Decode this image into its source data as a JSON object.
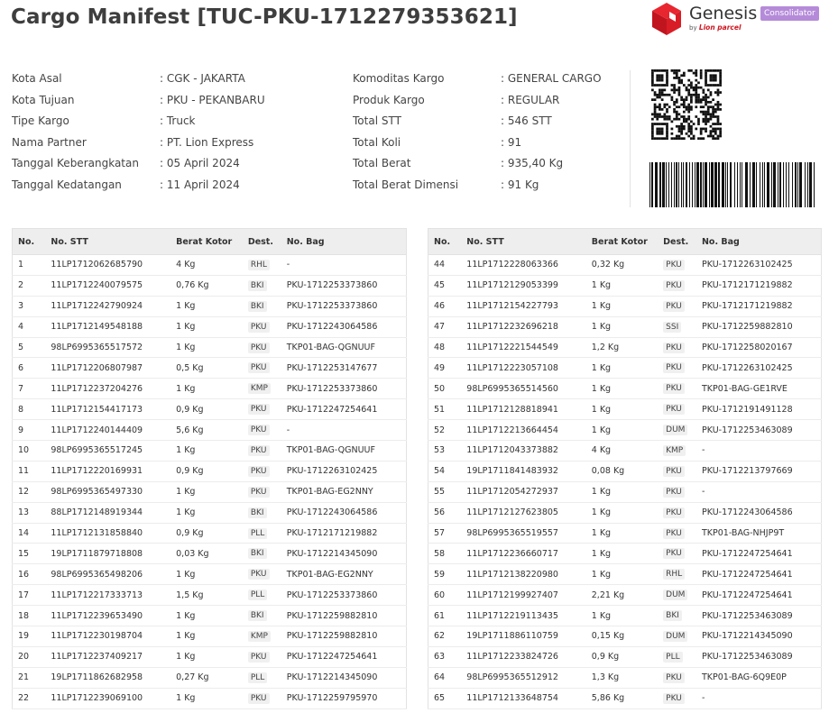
{
  "title": "Cargo Manifest [TUC-PKU-1712279353621]",
  "brand": {
    "name": "Genesis",
    "by": "by",
    "sub": "Lion parcel",
    "badge": "Consolidator",
    "accent": "#d0161f",
    "badge_color": "#b58bd9"
  },
  "info_left": [
    {
      "label": "Kota Asal",
      "value": ": CGK - JAKARTA"
    },
    {
      "label": "Kota Tujuan",
      "value": ": PKU - PEKANBARU"
    },
    {
      "label": "Tipe Kargo",
      "value": ": Truck"
    },
    {
      "label": "Nama Partner",
      "value": ": PT. Lion Express"
    },
    {
      "label": "Tanggal Keberangkatan",
      "value": ": 05 April 2024"
    },
    {
      "label": "Tanggal Kedatangan",
      "value": ": 11 April 2024"
    }
  ],
  "info_right": [
    {
      "label": "Komoditas Kargo",
      "value": ": GENERAL CARGO"
    },
    {
      "label": "Produk Kargo",
      "value": ": REGULAR"
    },
    {
      "label": "Total STT",
      "value": ": 546 STT"
    },
    {
      "label": "Total Koli",
      "value": ": 91"
    },
    {
      "label": "Total Berat",
      "value": ": 935,40 Kg"
    },
    {
      "label": "Total Berat Dimensi",
      "value": ": 91 Kg"
    }
  ],
  "table_headers": [
    "No.",
    "No. STT",
    "Berat Kotor",
    "Dest.",
    "No. Bag"
  ],
  "rows_left": [
    [
      "1",
      "11LP1712062685790",
      "4 Kg",
      "RHL",
      "-"
    ],
    [
      "2",
      "11LP1712240079575",
      "0,76 Kg",
      "BKI",
      "PKU-1712253373860"
    ],
    [
      "3",
      "11LP1712242790924",
      "1 Kg",
      "BKI",
      "PKU-1712253373860"
    ],
    [
      "4",
      "11LP1712149548188",
      "1 Kg",
      "PKU",
      "PKU-1712243064586"
    ],
    [
      "5",
      "98LP6995365517572",
      "1 Kg",
      "PKU",
      "TKP01-BAG-QGNUUF"
    ],
    [
      "6",
      "11LP1712206807987",
      "0,5 Kg",
      "PKU",
      "PKU-1712253147677"
    ],
    [
      "7",
      "11LP1712237204276",
      "1 Kg",
      "KMP",
      "PKU-1712253373860"
    ],
    [
      "8",
      "11LP1712154417173",
      "0,9 Kg",
      "PKU",
      "PKU-1712247254641"
    ],
    [
      "9",
      "11LP1712240144409",
      "5,6 Kg",
      "PKU",
      "-"
    ],
    [
      "10",
      "98LP6995365517245",
      "1 Kg",
      "PKU",
      "TKP01-BAG-QGNUUF"
    ],
    [
      "11",
      "11LP1712220169931",
      "0,9 Kg",
      "PKU",
      "PKU-1712263102425"
    ],
    [
      "12",
      "98LP6995365497330",
      "1 Kg",
      "PKU",
      "TKP01-BAG-EG2NNY"
    ],
    [
      "13",
      "88LP1712148919344",
      "1 Kg",
      "BKI",
      "PKU-1712243064586"
    ],
    [
      "14",
      "11LP1712131858840",
      "0,9 Kg",
      "PLL",
      "PKU-1712171219882"
    ],
    [
      "15",
      "19LP1711879718808",
      "0,03 Kg",
      "BKI",
      "PKU-1712214345090"
    ],
    [
      "16",
      "98LP6995365498206",
      "1 Kg",
      "PKU",
      "TKP01-BAG-EG2NNY"
    ],
    [
      "17",
      "11LP1712217333713",
      "1,5 Kg",
      "PLL",
      "PKU-1712253373860"
    ],
    [
      "18",
      "11LP1712239653490",
      "1 Kg",
      "BKI",
      "PKU-1712259882810"
    ],
    [
      "19",
      "11LP1712230198704",
      "1 Kg",
      "KMP",
      "PKU-1712259882810"
    ],
    [
      "20",
      "11LP1712237409217",
      "1 Kg",
      "PKU",
      "PKU-1712247254641"
    ],
    [
      "21",
      "19LP1711862682958",
      "0,27 Kg",
      "PLL",
      "PKU-1712214345090"
    ],
    [
      "22",
      "11LP1712239069100",
      "1 Kg",
      "PKU",
      "PKU-1712259795970"
    ]
  ],
  "rows_right": [
    [
      "44",
      "11LP1712228063366",
      "0,32 Kg",
      "PKU",
      "PKU-1712263102425"
    ],
    [
      "45",
      "11LP1712129053399",
      "1 Kg",
      "PKU",
      "PKU-1712171219882"
    ],
    [
      "46",
      "11LP1712154227793",
      "1 Kg",
      "PKU",
      "PKU-1712171219882"
    ],
    [
      "47",
      "11LP1712232696218",
      "1 Kg",
      "SSI",
      "PKU-1712259882810"
    ],
    [
      "48",
      "11LP1712221544549",
      "1,2 Kg",
      "PKU",
      "PKU-1712258020167"
    ],
    [
      "49",
      "11LP1712223057108",
      "1 Kg",
      "PKU",
      "PKU-1712263102425"
    ],
    [
      "50",
      "98LP6995365514560",
      "1 Kg",
      "PKU",
      "TKP01-BAG-GE1RVE"
    ],
    [
      "51",
      "11LP1712128818941",
      "1 Kg",
      "PKU",
      "PKU-1712191491128"
    ],
    [
      "52",
      "11LP1712213664454",
      "1 Kg",
      "DUM",
      "PKU-1712253463089"
    ],
    [
      "53",
      "11LP1712043373882",
      "4 Kg",
      "KMP",
      "-"
    ],
    [
      "54",
      "19LP1711841483932",
      "0,08 Kg",
      "PKU",
      "PKU-1712213797669"
    ],
    [
      "55",
      "11LP1712054272937",
      "1 Kg",
      "PKU",
      "-"
    ],
    [
      "56",
      "11LP1712127623805",
      "1 Kg",
      "PKU",
      "PKU-1712243064586"
    ],
    [
      "57",
      "98LP6995365519557",
      "1 Kg",
      "PKU",
      "TKP01-BAG-NHJP9T"
    ],
    [
      "58",
      "11LP1712236660717",
      "1 Kg",
      "PKU",
      "PKU-1712247254641"
    ],
    [
      "59",
      "11LP1712138220980",
      "1 Kg",
      "RHL",
      "PKU-1712247254641"
    ],
    [
      "60",
      "11LP1712199927407",
      "2,21 Kg",
      "DUM",
      "PKU-1712247254641"
    ],
    [
      "61",
      "11LP1712219113435",
      "1 Kg",
      "BKI",
      "PKU-1712253463089"
    ],
    [
      "62",
      "19LP1711886110759",
      "0,15 Kg",
      "DUM",
      "PKU-1712214345090"
    ],
    [
      "63",
      "11LP1712233824726",
      "0,9 Kg",
      "PLL",
      "PKU-1712253463089"
    ],
    [
      "64",
      "98LP6995365512912",
      "1,3 Kg",
      "PKU",
      "TKP01-BAG-6Q9E0P"
    ],
    [
      "65",
      "11LP1712133648754",
      "5,86 Kg",
      "PKU",
      "-"
    ]
  ]
}
